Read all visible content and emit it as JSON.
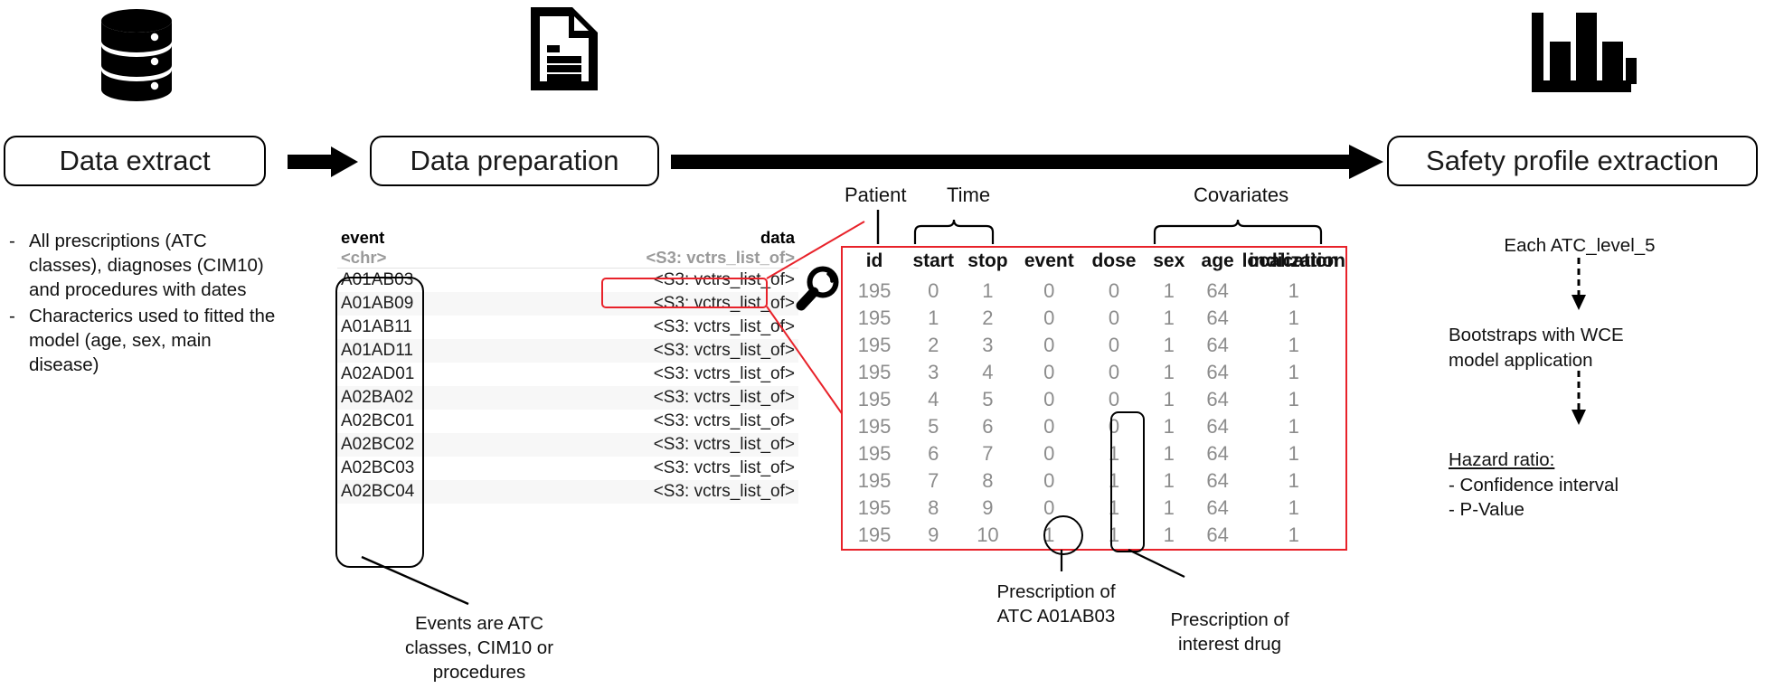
{
  "flow": {
    "steps": [
      {
        "label": "Data extract",
        "icon": "database-icon"
      },
      {
        "label": "Data preparation",
        "icon": "document-icon"
      },
      {
        "label": "Safety profile extraction",
        "icon": "bar-chart-icon"
      }
    ]
  },
  "left_notes": {
    "bullet_marker": "-",
    "items": [
      "All prescriptions (ATC classes), diagnoses (CIM10) and procedures with dates",
      "Characterics used to fitted the model (age, sex, main disease)"
    ]
  },
  "event_table": {
    "columns": [
      {
        "name": "event",
        "type": "<chr>"
      },
      {
        "name": "data",
        "type": "<S3: vctrs_list_of>"
      }
    ],
    "rows": [
      {
        "event": "A01AB03",
        "data": "<S3: vctrs_list_of>"
      },
      {
        "event": "A01AB09",
        "data": "<S3: vctrs_list_of>"
      },
      {
        "event": "A01AB11",
        "data": "<S3: vctrs_list_of>"
      },
      {
        "event": "A01AD11",
        "data": "<S3: vctrs_list_of>"
      },
      {
        "event": "A02AD01",
        "data": "<S3: vctrs_list_of>"
      },
      {
        "event": "A02BA02",
        "data": "<S3: vctrs_list_of>"
      },
      {
        "event": "A02BC01",
        "data": "<S3: vctrs_list_of>"
      },
      {
        "event": "A02BC02",
        "data": "<S3: vctrs_list_of>"
      },
      {
        "event": "A02BC03",
        "data": "<S3: vctrs_list_of>"
      },
      {
        "event": "A02BC04",
        "data": "<S3: vctrs_list_of>"
      }
    ],
    "caption": "Events are ATC classes, CIM10 or procedures"
  },
  "data_table": {
    "group_labels": {
      "patient": "Patient",
      "time": "Time",
      "covariates": "Covariates"
    },
    "columns": [
      "id",
      "start",
      "stop",
      "event",
      "dose",
      "sex",
      "age",
      "indication",
      "localization"
    ],
    "rows": [
      [
        "195",
        "0",
        "1",
        "0",
        "0",
        "1",
        "64",
        "1"
      ],
      [
        "195",
        "1",
        "2",
        "0",
        "0",
        "1",
        "64",
        "1"
      ],
      [
        "195",
        "2",
        "3",
        "0",
        "0",
        "1",
        "64",
        "1"
      ],
      [
        "195",
        "3",
        "4",
        "0",
        "0",
        "1",
        "64",
        "1"
      ],
      [
        "195",
        "4",
        "5",
        "0",
        "0",
        "1",
        "64",
        "1"
      ],
      [
        "195",
        "5",
        "6",
        "0",
        "0",
        "1",
        "64",
        "1"
      ],
      [
        "195",
        "6",
        "7",
        "0",
        "1",
        "1",
        "64",
        "1"
      ],
      [
        "195",
        "7",
        "8",
        "0",
        "1",
        "1",
        "64",
        "1"
      ],
      [
        "195",
        "8",
        "9",
        "0",
        "1",
        "1",
        "64",
        "1"
      ],
      [
        "195",
        "9",
        "10",
        "1",
        "1",
        "1",
        "64",
        "1"
      ]
    ],
    "annotations": {
      "event_circle": "Prescription of ATC A01AB03",
      "dose_box": "Prescription of interest drug"
    }
  },
  "right_panel": {
    "step1": "Each ATC_level_5",
    "step2": "Bootstraps with WCE model application",
    "result_title": "Hazard ratio:",
    "result_items": [
      "- Confidence interval",
      "- P-Value"
    ]
  },
  "colors": {
    "accent_red": "#e8222a",
    "ink": "#000000",
    "muted": "#8c8c8c",
    "subtle": "#9a9a9a"
  }
}
